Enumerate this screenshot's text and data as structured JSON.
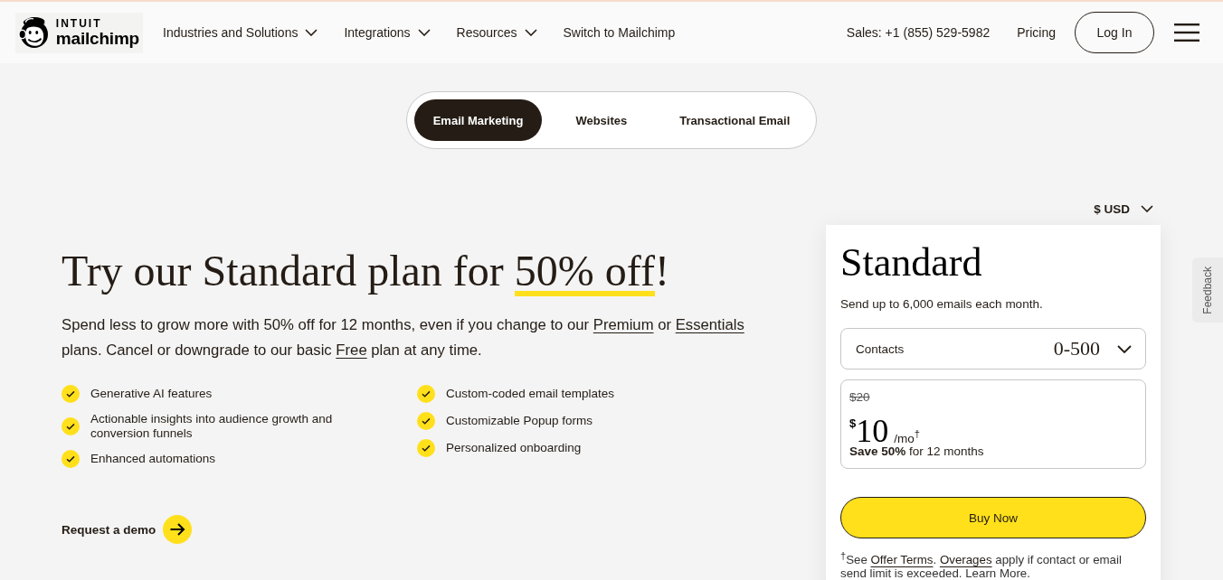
{
  "header": {
    "logo": {
      "small": "INTUIT",
      "wordmark": "mailchimp"
    },
    "nav": [
      {
        "label": "Industries and Solutions",
        "has_menu": true
      },
      {
        "label": "Integrations",
        "has_menu": true
      },
      {
        "label": "Resources",
        "has_menu": true
      },
      {
        "label": "Switch to Mailchimp",
        "has_menu": false
      }
    ],
    "sales": "Sales: +1 (855) 529-5982",
    "pricing": "Pricing",
    "login": "Log In"
  },
  "product_tabs": [
    {
      "label": "Email Marketing",
      "selected": true
    },
    {
      "label": "Websites",
      "selected": false
    },
    {
      "label": "Transactional Email",
      "selected": false
    }
  ],
  "hero": {
    "headline": {
      "before": "Try our Standard plan for ",
      "highlight": "50% off",
      "after": "!"
    },
    "intro": [
      {
        "kind": "text",
        "text": "Spend less to grow more with 50% off for 12 months, even if you change to our "
      },
      {
        "kind": "link",
        "text": "Premium"
      },
      {
        "kind": "text",
        "text": " or "
      },
      {
        "kind": "link",
        "text": "Essentials"
      },
      {
        "kind": "text",
        "text": " plans. Cancel or downgrade to our basic "
      },
      {
        "kind": "link",
        "text": "Free"
      },
      {
        "kind": "text",
        "text": " plan at any time."
      }
    ],
    "feature_columns": [
      {
        "items": [
          "Generative AI features",
          "Actionable insights into audience growth and conversion funnels",
          "Enhanced automations"
        ]
      },
      {
        "items": [
          "Custom-coded email templates",
          "Customizable Popup forms",
          "Personalized onboarding"
        ]
      }
    ],
    "demo_link": "Request a demo"
  },
  "plan_card": {
    "currency": "$ USD",
    "name": "Standard",
    "description": "Send up to 6,000 emails each month.",
    "contacts": {
      "label": "Contacts",
      "value": "0-500"
    },
    "price": {
      "old": "$20",
      "currency": "$",
      "amount": "10",
      "period": "/mo$^{†}$",
      "savings": "**Save 50%** for 12 months"
    },
    "button": "Buy Now",
    "footnote": [
      {
        "kind": "text",
        "text": "$^{†}$See "
      },
      {
        "kind": "link",
        "text": "Offer Terms"
      },
      {
        "kind": "text",
        "text": ". "
      },
      {
        "kind": "link",
        "text": "Overages"
      },
      {
        "kind": "text",
        "text": " apply if contact or email send limit is exceeded. Learn More."
      }
    ]
  },
  "feedback": "Feedback"
}
